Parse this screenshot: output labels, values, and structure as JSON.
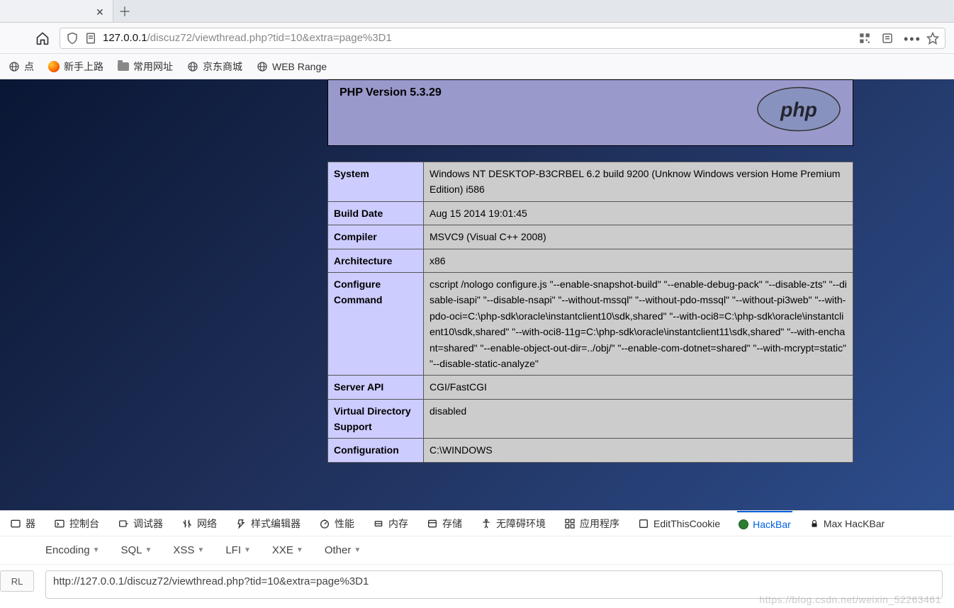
{
  "browser": {
    "url_host": "127.0.0.1",
    "url_rest": "/discuz72/viewthread.php?tid=10&extra=page%3D1",
    "bookmarks": [
      {
        "label": "点",
        "icon": "globe"
      },
      {
        "label": "新手上路",
        "icon": "firefox"
      },
      {
        "label": "常用网址",
        "icon": "folder"
      },
      {
        "label": "京东商城",
        "icon": "globe"
      },
      {
        "label": "WEB Range",
        "icon": "globe"
      }
    ]
  },
  "phpinfo": {
    "title": "PHP Version 5.3.29",
    "rows": [
      {
        "k": "System",
        "v": "Windows NT DESKTOP-B3CRBEL 6.2 build 9200 (Unknow Windows version Home Premium Edition) i586"
      },
      {
        "k": "Build Date",
        "v": "Aug 15 2014 19:01:45"
      },
      {
        "k": "Compiler",
        "v": "MSVC9 (Visual C++ 2008)"
      },
      {
        "k": "Architecture",
        "v": "x86"
      },
      {
        "k": "Configure Command",
        "v": "cscript /nologo configure.js \"--enable-snapshot-build\" \"--enable-debug-pack\" \"--disable-zts\" \"--disable-isapi\" \"--disable-nsapi\" \"--without-mssql\" \"--without-pdo-mssql\" \"--without-pi3web\" \"--with-pdo-oci=C:\\php-sdk\\oracle\\instantclient10\\sdk,shared\" \"--with-oci8=C:\\php-sdk\\oracle\\instantclient10\\sdk,shared\" \"--with-oci8-11g=C:\\php-sdk\\oracle\\instantclient11\\sdk,shared\" \"--with-enchant=shared\" \"--enable-object-out-dir=../obj/\" \"--enable-com-dotnet=shared\" \"--with-mcrypt=static\" \"--disable-static-analyze\""
      },
      {
        "k": "Server API",
        "v": "CGI/FastCGI"
      },
      {
        "k": "Virtual Directory Support",
        "v": "disabled"
      },
      {
        "k": "Configuration",
        "v": "C:\\WINDOWS"
      }
    ]
  },
  "devtools": {
    "tabs": [
      "器",
      "控制台",
      "调试器",
      "网络",
      "样式编辑器",
      "性能",
      "内存",
      "存储",
      "无障碍环境",
      "应用程序",
      "EditThisCookie",
      "HackBar",
      "Max HacKBar"
    ],
    "active": "HackBar"
  },
  "hackbar": {
    "menus": [
      "Encoding",
      "SQL",
      "XSS",
      "LFI",
      "XXE",
      "Other"
    ],
    "url_label": "RL",
    "url_value": "http://127.0.0.1/discuz72/viewthread.php?tid=10&extra=page%3D1"
  },
  "watermark": "https://blog.csdn.net/weixin_52263461"
}
